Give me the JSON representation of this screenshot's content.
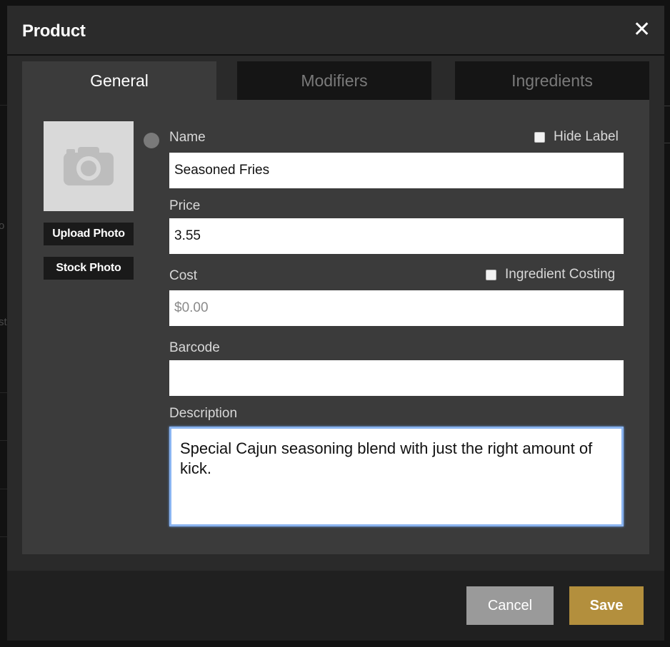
{
  "modal": {
    "title": "Product",
    "close_icon": "close-icon",
    "close_glyph": "✕"
  },
  "tabs": [
    {
      "label": "General",
      "active": true
    },
    {
      "label": "Modifiers",
      "active": false
    },
    {
      "label": "Ingredients",
      "active": false
    }
  ],
  "photo": {
    "placeholder_icon": "camera-icon",
    "upload_label": "Upload Photo",
    "stock_label": "Stock Photo"
  },
  "form": {
    "name_label": "Name",
    "name_value": "Seasoned Fries",
    "hide_label": "Hide Label",
    "price_label": "Price",
    "price_value": "3.55",
    "cost_label": "Cost",
    "cost_placeholder": "$0.00",
    "ingredient_costing_label": "Ingredient Costing",
    "barcode_label": "Barcode",
    "barcode_value": "",
    "description_label": "Description",
    "description_value": "Special Cajun seasoning blend with just the right amount of kick."
  },
  "footer": {
    "cancel_label": "Cancel",
    "save_label": "Save"
  },
  "colors": {
    "accent_save": "#b38f3d",
    "cancel": "#9a9a9a",
    "focus_ring": "#8ab4f0"
  }
}
